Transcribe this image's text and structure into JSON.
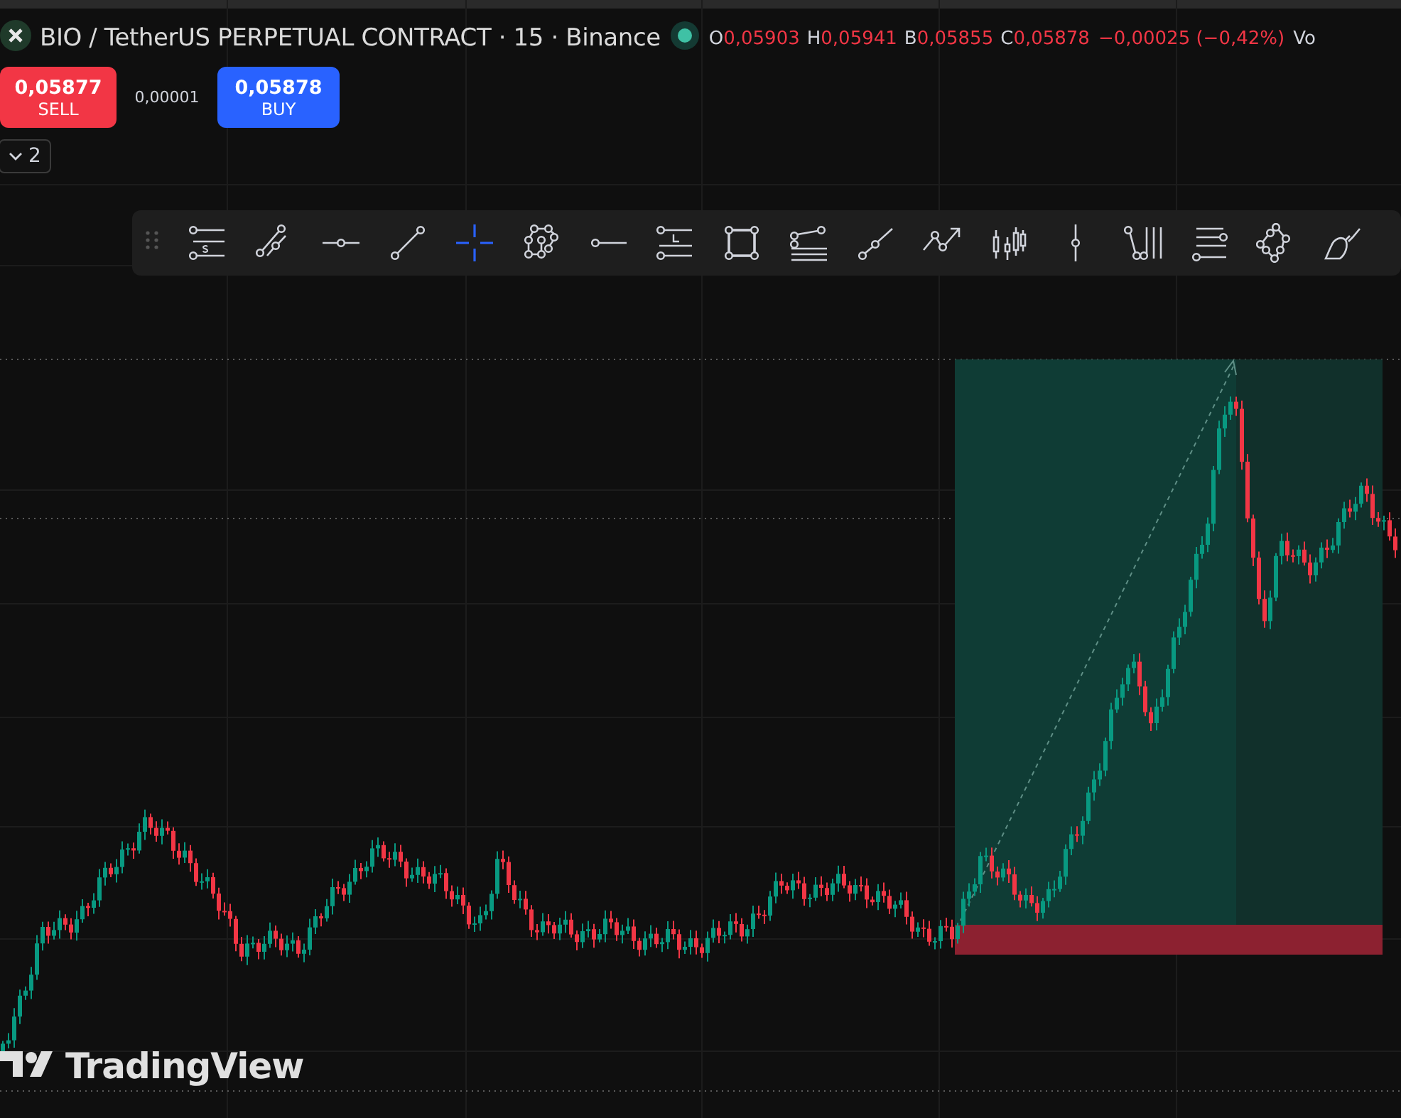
{
  "header": {
    "title": "BIO / TetherUS PERPETUAL CONTRACT · 15 · Binance",
    "ohlc": [
      {
        "label": "O",
        "value": "0,05903"
      },
      {
        "label": "H",
        "value": "0,05941"
      },
      {
        "label": "B",
        "value": "0,05855"
      },
      {
        "label": "C",
        "value": "0,05878"
      }
    ],
    "change": "−0,00025 (−0,42%)",
    "volume_label": "Vo"
  },
  "trade": {
    "sell": {
      "price": "0,05877",
      "label": "SELL"
    },
    "spread": "0,00001",
    "buy": {
      "price": "0,05878",
      "label": "BUY"
    }
  },
  "indicators_toggle": {
    "count": "2"
  },
  "drawing_toolbar": {
    "tools": [
      {
        "kind": "s-channel",
        "selected": false
      },
      {
        "kind": "double-segment",
        "selected": false
      },
      {
        "kind": "horizontal-line",
        "selected": false
      },
      {
        "kind": "trend-line",
        "selected": false
      },
      {
        "kind": "crosshair",
        "selected": true
      },
      {
        "kind": "polygon-points",
        "selected": false
      },
      {
        "kind": "horizontal-ray",
        "selected": false
      },
      {
        "kind": "l-channel",
        "selected": false
      },
      {
        "kind": "rectangle",
        "selected": false
      },
      {
        "kind": "fib-lines",
        "selected": false
      },
      {
        "kind": "ray",
        "selected": false
      },
      {
        "kind": "path-arrow",
        "selected": false
      },
      {
        "kind": "candles",
        "selected": false
      },
      {
        "kind": "vertical-line",
        "selected": false
      },
      {
        "kind": "pitchfork",
        "selected": false
      },
      {
        "kind": "fib-channel",
        "selected": false
      },
      {
        "kind": "pattern",
        "selected": false
      },
      {
        "kind": "brush",
        "selected": false
      }
    ]
  },
  "logo": {
    "text": "TradingView"
  }
}
